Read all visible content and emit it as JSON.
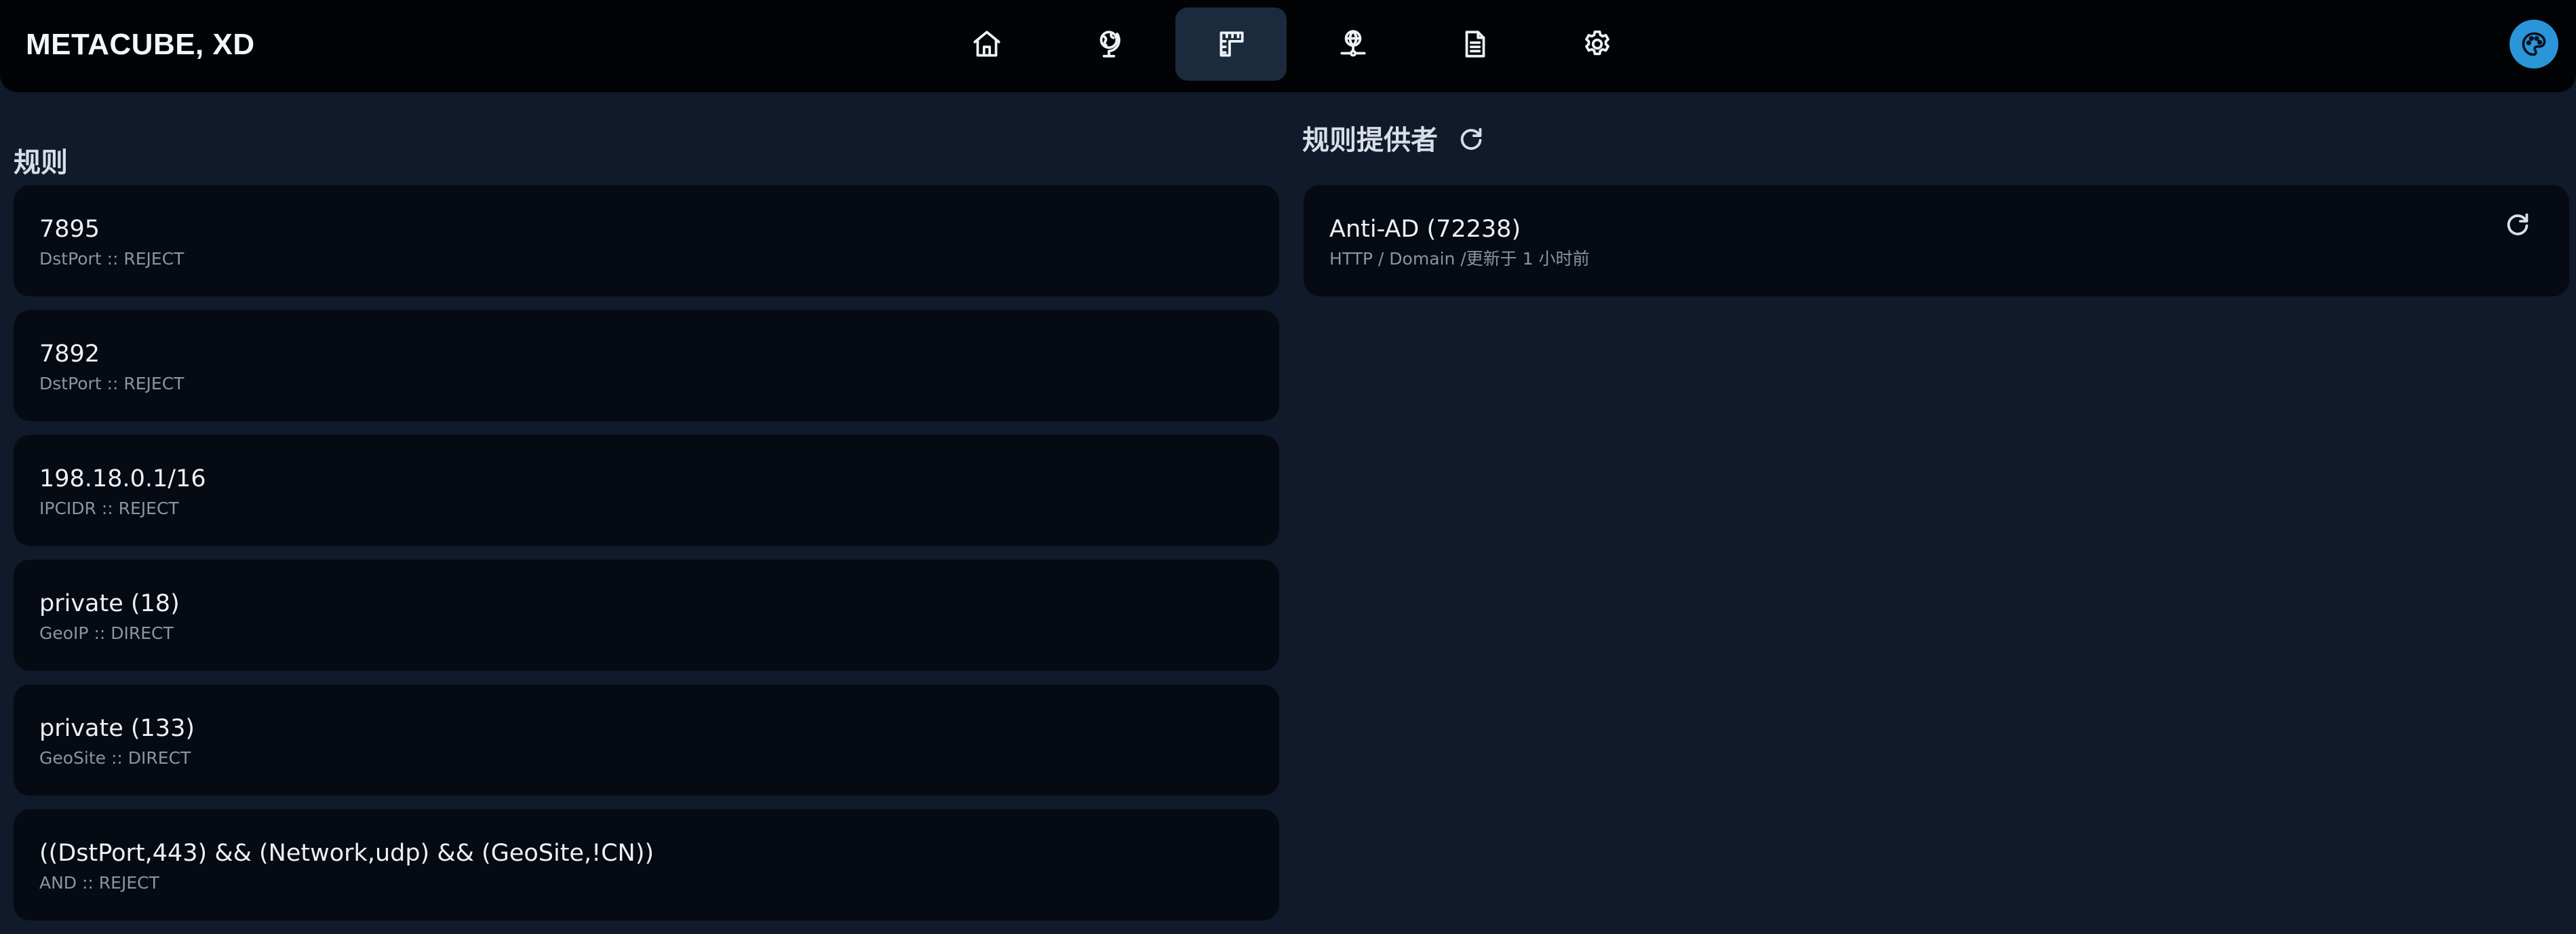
{
  "header": {
    "brand": "METACUBE, XD",
    "nav": [
      {
        "name": "home",
        "icon": "home-icon",
        "active": false
      },
      {
        "name": "proxies",
        "icon": "globe-stand-icon",
        "active": false
      },
      {
        "name": "rules",
        "icon": "ruler-icon",
        "active": true
      },
      {
        "name": "connections",
        "icon": "network-globe-icon",
        "active": false
      },
      {
        "name": "logs",
        "icon": "file-text-icon",
        "active": false
      },
      {
        "name": "settings",
        "icon": "gear-icon",
        "active": false
      }
    ],
    "theme_icon": "palette-icon",
    "theme_color": "#2a95d8"
  },
  "rules": {
    "title": "规则",
    "items": [
      {
        "payload": "7895",
        "meta": "DstPort :: REJECT"
      },
      {
        "payload": "7892",
        "meta": "DstPort :: REJECT"
      },
      {
        "payload": "198.18.0.1/16",
        "meta": "IPCIDR :: REJECT"
      },
      {
        "payload": "private (18)",
        "meta": "GeoIP :: DIRECT"
      },
      {
        "payload": "private (133)",
        "meta": "GeoSite :: DIRECT"
      },
      {
        "payload": "((DstPort,443) && (Network,udp) && (GeoSite,!CN))",
        "meta": "AND :: REJECT"
      }
    ]
  },
  "providers": {
    "title": "规则提供者",
    "refresh_icon": "refresh-icon",
    "items": [
      {
        "name": "Anti-AD (72238)",
        "meta": "HTTP / Domain /更新于 1 小时前"
      }
    ]
  },
  "colors": {
    "background": "#111a2b",
    "header": "#020305",
    "card": "#060a12",
    "active_nav": "#1c2a3d",
    "muted_text": "#8b94a3"
  }
}
